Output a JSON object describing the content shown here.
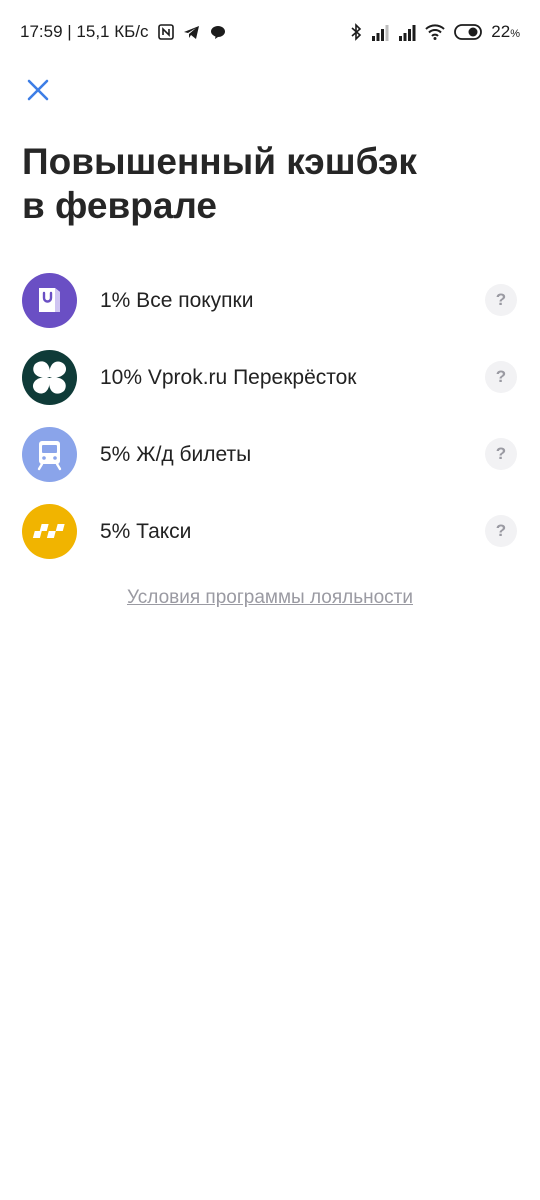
{
  "status_bar": {
    "time": "17:59 | 15,1 КБ/с",
    "battery": "22",
    "battery_unit": "%"
  },
  "header": {
    "close_icon": "close-icon",
    "title_line1": "Повышенный кэшбэк",
    "title_line2": "в феврале"
  },
  "cashback": {
    "items": [
      {
        "label": "1% Все покупки",
        "icon": "shopping-bag-icon",
        "color": "#6a4fc4"
      },
      {
        "label": "10% Vprok.ru Перекрёсток",
        "icon": "perekrestok-logo",
        "color": "#0f3b38"
      },
      {
        "label": "5% Ж/д билеты",
        "icon": "train-icon",
        "color": "#8aa4ea"
      },
      {
        "label": "5% Такси",
        "icon": "taxi-icon",
        "color": "#f1b400"
      }
    ],
    "help_label": "?"
  },
  "footer": {
    "terms_link": "Условия программы лояльности"
  },
  "colors": {
    "close": "#3d7ee6",
    "link": "#9a9aa2",
    "help_bg": "#f2f2f4"
  }
}
